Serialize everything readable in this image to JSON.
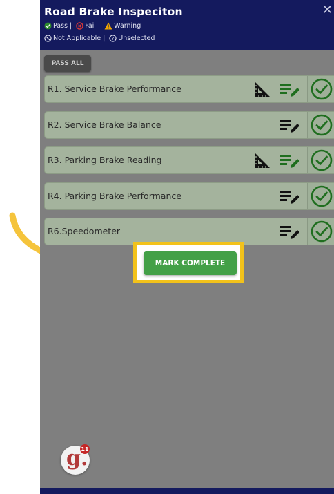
{
  "header": {
    "title": "Road Brake Inspeciton",
    "close_glyph": "✕",
    "legend_line1": [
      {
        "icon": "pass-icon",
        "label": "Pass |"
      },
      {
        "icon": "fail-icon",
        "label": "Fail |"
      },
      {
        "icon": "warning-icon",
        "label": "Warning"
      }
    ],
    "legend_line2": [
      {
        "icon": "not-applicable-icon",
        "label": "Not Applicable |"
      },
      {
        "icon": "unselected-icon",
        "label": "Unselected"
      }
    ]
  },
  "pass_all_label": "PASS ALL",
  "items": [
    {
      "label": "R1. Service Brake Performance",
      "has_ruler": true,
      "notes_color": "#1f6e1f",
      "status": "pass"
    },
    {
      "label": "R2. Service Brake Balance",
      "has_ruler": false,
      "notes_color": "#111111",
      "status": "pass"
    },
    {
      "label": "R3. Parking Brake Reading",
      "has_ruler": true,
      "notes_color": "#1f6e1f",
      "status": "pass"
    },
    {
      "label": "R4. Parking Brake Performance",
      "has_ruler": false,
      "notes_color": "#111111",
      "status": "pass"
    },
    {
      "label": "R6.Speedometer",
      "has_ruler": false,
      "notes_color": "#111111",
      "status": "pass"
    }
  ],
  "mark_complete_label": "MARK COMPLETE",
  "logo": {
    "letter": "g.",
    "badge": "11"
  },
  "colors": {
    "header_bg": "#141a5e",
    "pass_green": "#1f6e1f",
    "highlight": "#f2c21b",
    "button_green": "#43a047"
  }
}
